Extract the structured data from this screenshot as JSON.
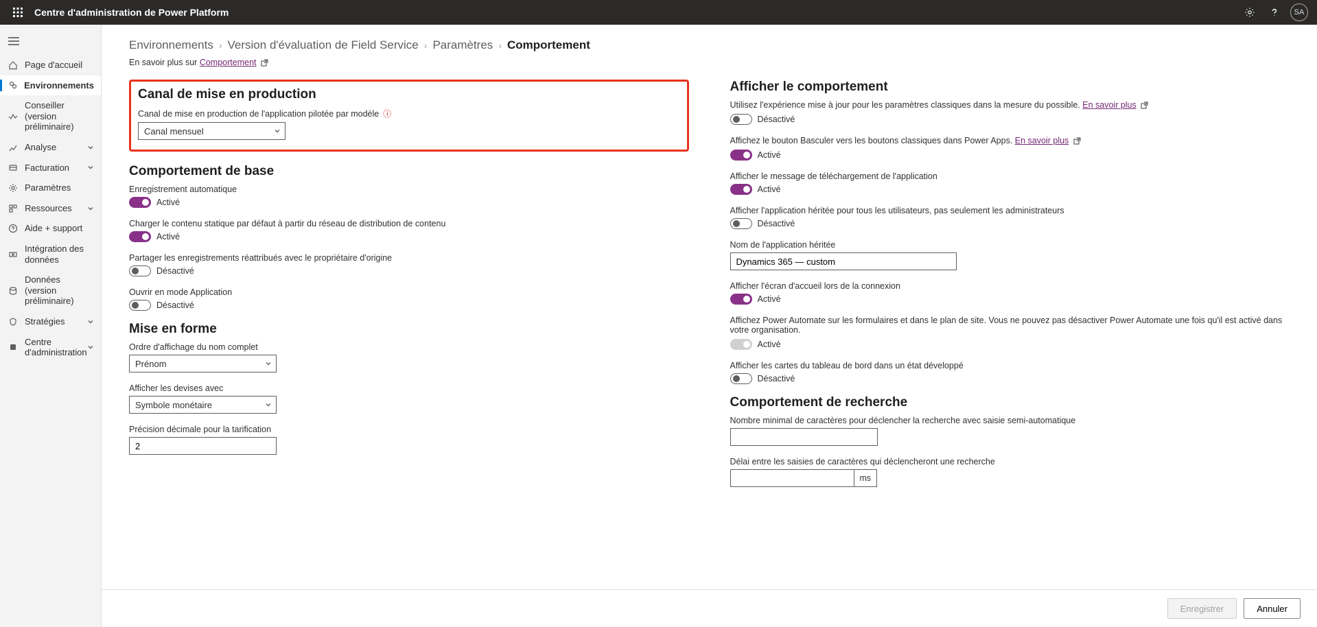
{
  "topbar": {
    "title": "Centre d'administration de Power Platform",
    "avatar": "SA"
  },
  "sidebar": {
    "items": [
      {
        "label": "Page d'accueil"
      },
      {
        "label": "Environnements"
      },
      {
        "label": "Conseiller (version préliminaire)"
      },
      {
        "label": "Analyse"
      },
      {
        "label": "Facturation"
      },
      {
        "label": "Paramètres"
      },
      {
        "label": "Ressources"
      },
      {
        "label": "Aide + support"
      },
      {
        "label": "Intégration des données"
      },
      {
        "label": "Données (version préliminaire)"
      },
      {
        "label": "Stratégies"
      },
      {
        "label": "Centre d'administration"
      }
    ]
  },
  "breadcrumb": {
    "c0": "Environnements",
    "c1": "Version d'évaluation de Field Service",
    "c2": "Paramètres",
    "c3": "Comportement"
  },
  "learn": {
    "prefix": "En savoir plus sur ",
    "link": "Comportement"
  },
  "left": {
    "release": {
      "title": "Canal de mise en production",
      "field_label": "Canal de mise en production de l'application pilotée par modèle",
      "value": "Canal mensuel"
    },
    "basic": {
      "title": "Comportement de base",
      "autosave_label": "Enregistrement automatique",
      "cdn_label": "Charger le contenu statique par défaut à partir du réseau de distribution de contenu",
      "share_label": "Partager les enregistrements réattribués avec le propriétaire d'origine",
      "appmode_label": "Ouvrir en mode Application"
    },
    "format": {
      "title": "Mise en forme",
      "nameorder_label": "Ordre d'affichage du nom complet",
      "nameorder_value": "Prénom",
      "currency_label": "Afficher les devises avec",
      "currency_value": "Symbole monétaire",
      "precision_label": "Précision décimale pour la tarification",
      "precision_value": "2"
    }
  },
  "right": {
    "display": {
      "title": "Afficher le comportement",
      "updated_exp_label": "Utilisez l'expérience mise à jour pour les paramètres classiques dans la mesure du possible. ",
      "learn_more": "En savoir plus",
      "toggle_classic_label": "Affichez le bouton Basculer vers les boutons classiques dans Power Apps. ",
      "download_msg_label": "Afficher le message de téléchargement de l'application",
      "legacy_all_label": "Afficher l'application héritée pour tous les utilisateurs, pas seulement les administrateurs",
      "legacy_name_label": "Nom de l'application héritée",
      "legacy_name_value": "Dynamics 365 — custom",
      "welcome_label": "Afficher l'écran d'accueil lors de la connexion",
      "powerautomate_label": "Affichez Power Automate sur les formulaires et dans le plan de site. Vous ne pouvez pas désactiver Power Automate une fois qu'il est activé dans votre organisation.",
      "dashboard_expand_label": "Afficher les cartes du tableau de bord dans un état développé"
    },
    "search": {
      "title": "Comportement de recherche",
      "min_chars_label": "Nombre minimal de caractères pour déclencher la recherche avec saisie semi-automatique",
      "delay_label": "Délai entre les saisies de caractères qui déclencheront une recherche",
      "delay_suffix": "ms"
    }
  },
  "states": {
    "on": "Activé",
    "off": "Désactivé"
  },
  "footer": {
    "save": "Enregistrer",
    "cancel": "Annuler"
  }
}
